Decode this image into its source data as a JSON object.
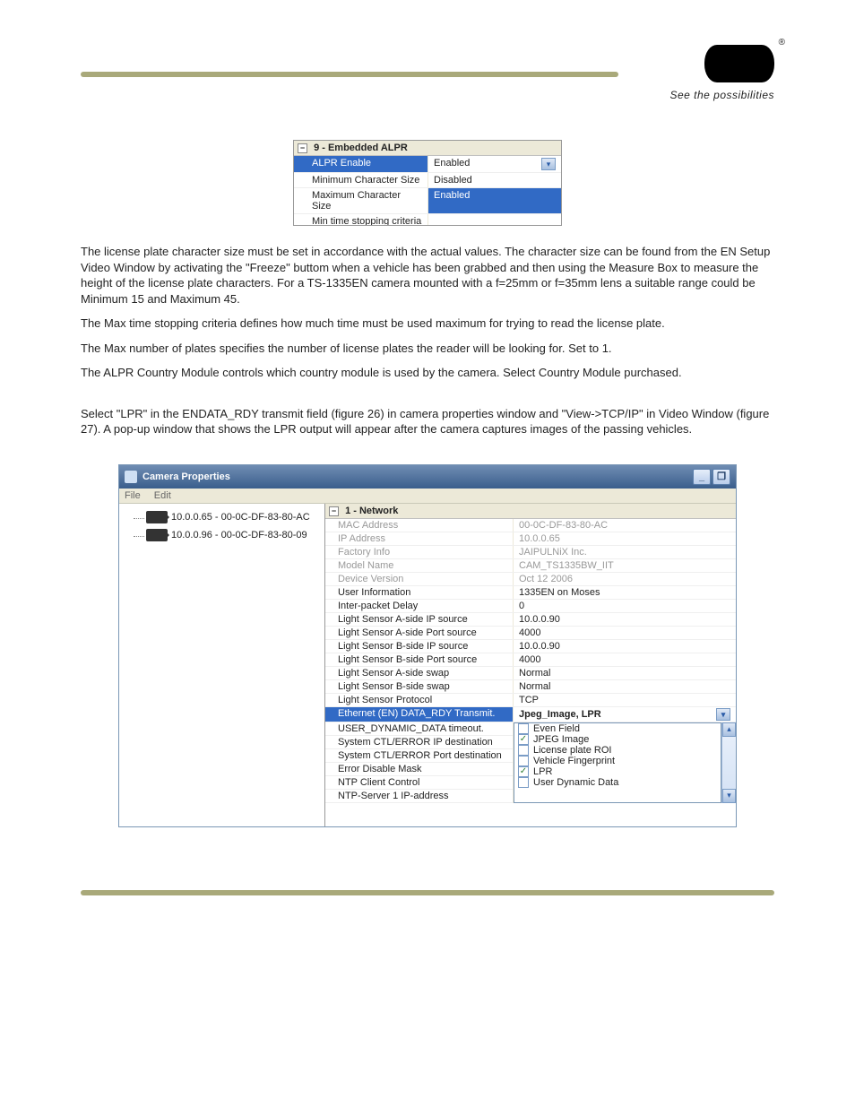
{
  "brand": {
    "tagline": "See the possibilities",
    "registered": "®"
  },
  "paragraphs": {
    "p1": "The license plate character size must be set in accordance with the actual values. The character size can be found from the EN Setup Video Window by activating the \"Freeze\" buttom when a vehicle has been grabbed and then using the Measure Box to measure the height of the license plate characters. For a TS-1335EN camera mounted with a f=25mm or f=35mm lens a suitable range could be Minimum 15 and Maximum 45.",
    "p2": "The Max time stopping criteria defines how much time must be used maximum for trying to read the license plate.",
    "p3": "The Max number of plates specifies the number of license plates the reader will be looking for. Set to 1.",
    "p4": "The ALPR Country Module controls which country module is used by the camera. Select Country Module purchased.",
    "p5": "Select \"LPR\" in the ENDATA_RDY transmit field (figure 26) in camera properties window and \"View->TCP/IP\" in Video Window (figure 27). A pop-up window that shows the LPR output will appear after the camera captures images of the passing vehicles."
  },
  "alpr_grid": {
    "header": "9 - Embedded ALPR",
    "collapse_glyph": "−",
    "rows": [
      {
        "label": "ALPR Enable",
        "value": "Enabled",
        "selected": true,
        "hasArrow": true
      },
      {
        "label": "Minimum Character Size",
        "value": "Disabled"
      },
      {
        "label": "Maximum Character Size",
        "value": "Enabled",
        "valueSelected": true
      }
    ],
    "cut_label": "Min time stopping criteria"
  },
  "camera_properties": {
    "title": "Camera Properties",
    "menu": {
      "file": "File",
      "edit": "Edit"
    },
    "tree": [
      "10.0.0.65 - 00-0C-DF-83-80-AC",
      "10.0.0.96 - 00-0C-DF-83-80-09"
    ],
    "grid_header": "1 - Network",
    "collapse_glyph": "−",
    "rows": [
      {
        "label": "MAC Address",
        "value": "00-0C-DF-83-80-AC",
        "disabled": true
      },
      {
        "label": "IP Address",
        "value": "10.0.0.65",
        "disabled": true
      },
      {
        "label": "Factory Info",
        "value": "JAIPULNiX Inc.",
        "disabled": true
      },
      {
        "label": "Model Name",
        "value": "CAM_TS1335BW_IIT",
        "disabled": true
      },
      {
        "label": "Device Version",
        "value": "Oct 12 2006",
        "disabled": true
      },
      {
        "label": "User Information",
        "value": "1335EN on Moses"
      },
      {
        "label": "Inter-packet Delay",
        "value": "0"
      },
      {
        "label": "Light Sensor A-side IP source",
        "value": "10.0.0.90"
      },
      {
        "label": "Light Sensor A-side Port source",
        "value": "4000"
      },
      {
        "label": "Light Sensor B-side IP source",
        "value": "10.0.0.90"
      },
      {
        "label": "Light Sensor B-side Port source",
        "value": "4000"
      },
      {
        "label": "Light Sensor A-side swap",
        "value": "Normal"
      },
      {
        "label": "Light Sensor B-side swap",
        "value": "Normal"
      },
      {
        "label": "Light Sensor Protocol",
        "value": "TCP"
      }
    ],
    "selected_row": {
      "label": "Ethernet (EN) DATA_RDY Transmit.",
      "value": "Jpeg_Image, LPR"
    },
    "dropdown_left_labels": [
      "USER_DYNAMIC_DATA timeout.",
      "System CTL/ERROR IP destination",
      "System CTL/ERROR Port destination",
      "Error Disable Mask",
      "NTP Client Control",
      "NTP-Server 1 IP-address"
    ],
    "dropdown_options": [
      {
        "label": "Even Field",
        "checked": false
      },
      {
        "label": "JPEG Image",
        "checked": true
      },
      {
        "label": "License plate ROI",
        "checked": false
      },
      {
        "label": "Vehicle Fingerprint",
        "checked": false
      },
      {
        "label": "LPR",
        "checked": true
      },
      {
        "label": "User Dynamic Data",
        "checked": false
      }
    ]
  },
  "glyphs": {
    "down": "▾",
    "up": "▴",
    "minimize": "_",
    "restore": "❐"
  }
}
